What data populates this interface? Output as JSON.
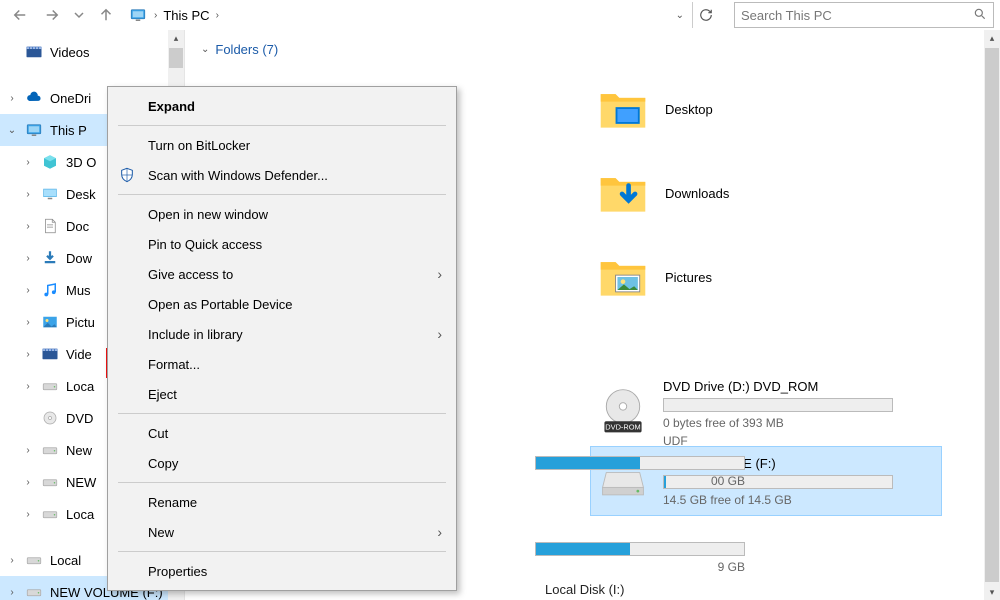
{
  "address": {
    "location": "This PC",
    "chevron": "›"
  },
  "search": {
    "placeholder": "Search This PC"
  },
  "tree": {
    "items": [
      {
        "label": "Videos",
        "icon": "videos",
        "chev": ""
      },
      {
        "label": "OneDri",
        "icon": "onedrive",
        "chev": "›"
      },
      {
        "label": "This P",
        "icon": "thispc",
        "chev": "⌄",
        "sel": true
      },
      {
        "label": "3D O",
        "icon": "3d",
        "chev": "›",
        "indent": true
      },
      {
        "label": "Desk",
        "icon": "desktop",
        "chev": "›",
        "indent": true
      },
      {
        "label": "Doc",
        "icon": "documents",
        "chev": "›",
        "indent": true
      },
      {
        "label": "Dow",
        "icon": "downloads",
        "chev": "›",
        "indent": true
      },
      {
        "label": "Mus",
        "icon": "music",
        "chev": "›",
        "indent": true
      },
      {
        "label": "Pictu",
        "icon": "pictures",
        "chev": "›",
        "indent": true
      },
      {
        "label": "Vide",
        "icon": "videos",
        "chev": "›",
        "indent": true
      },
      {
        "label": "Loca",
        "icon": "drive",
        "chev": "›",
        "indent": true
      },
      {
        "label": "DVD",
        "icon": "dvd",
        "chev": "",
        "indent": true
      },
      {
        "label": "New",
        "icon": "drive",
        "chev": "›",
        "indent": true
      },
      {
        "label": "NEW",
        "icon": "drive",
        "chev": "›",
        "indent": true
      },
      {
        "label": "Loca",
        "icon": "drive",
        "chev": "›",
        "indent": true
      },
      {
        "label": "Local",
        "icon": "drive",
        "chev": "›"
      },
      {
        "label": "NEW VOLUME (F:)",
        "icon": "drive",
        "chev": "›",
        "sel2": true
      }
    ]
  },
  "section": {
    "title": "Folders (7)"
  },
  "folders": [
    {
      "label": "Desktop",
      "icon": "desktop-big"
    },
    {
      "label": "Downloads",
      "icon": "downloads-big"
    },
    {
      "label": "Pictures",
      "icon": "pictures-big"
    }
  ],
  "drives_visible": [
    {
      "name": "DVD Drive (D:) DVD_ROM",
      "sub1": "0 bytes free of 393 MB",
      "sub2": "UDF",
      "badge": "DVD-ROM",
      "icon": "dvd-big",
      "bar": 0,
      "sel": false
    },
    {
      "name": "NEW VOLUME (F:)",
      "sub1": "14.5 GB free of 14.5 GB",
      "sub2": "",
      "icon": "drive-big",
      "bar": 1,
      "sel": true
    }
  ],
  "partial_drives": [
    {
      "sub": "00 GB"
    },
    {
      "sub": "9 GB"
    }
  ],
  "bottom_partial": "Local Disk (I:)",
  "context_menu": {
    "items": [
      {
        "label": "Expand",
        "bold": true
      },
      {
        "sep": true
      },
      {
        "label": "Turn on BitLocker"
      },
      {
        "label": "Scan with Windows Defender...",
        "icon": "defender"
      },
      {
        "sep": true
      },
      {
        "label": "Open in new window"
      },
      {
        "label": "Pin to Quick access"
      },
      {
        "label": "Give access to",
        "arr": true
      },
      {
        "label": "Open as Portable Device"
      },
      {
        "label": "Include in library",
        "arr": true
      },
      {
        "label": "Format...",
        "hilite": true
      },
      {
        "label": "Eject"
      },
      {
        "sep": true
      },
      {
        "label": "Cut"
      },
      {
        "label": "Copy"
      },
      {
        "sep": true
      },
      {
        "label": "Rename"
      },
      {
        "label": "New",
        "arr": true
      },
      {
        "sep": true
      },
      {
        "label": "Properties"
      }
    ]
  }
}
